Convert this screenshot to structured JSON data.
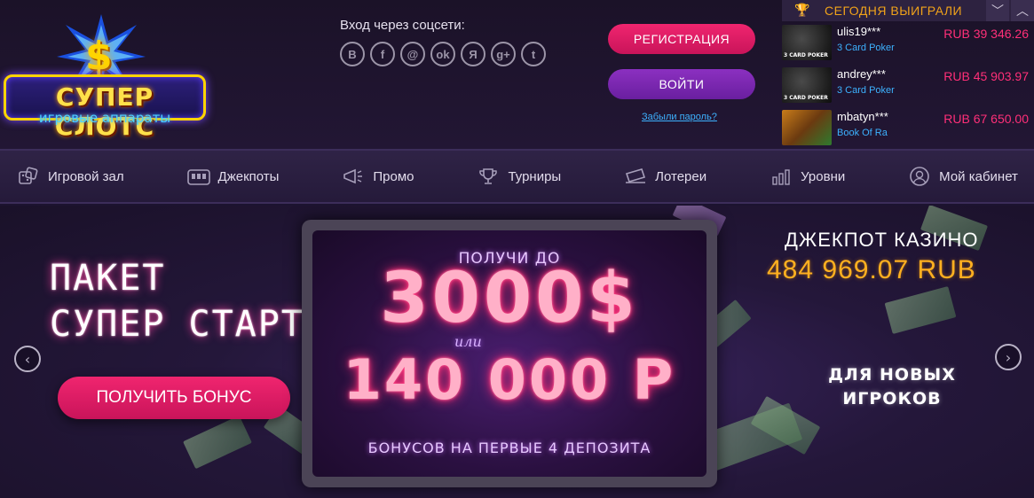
{
  "logo": {
    "title": "СУПЕР СЛОТС",
    "dollar": "$",
    "subtitle": "игровые аппараты"
  },
  "social": {
    "title": "Вход через соцсети:",
    "icons": [
      {
        "name": "vk-icon",
        "glyph": "В"
      },
      {
        "name": "facebook-icon",
        "glyph": "f"
      },
      {
        "name": "mail-icon",
        "glyph": "@"
      },
      {
        "name": "odnoklassniki-icon",
        "glyph": "ok"
      },
      {
        "name": "yandex-icon",
        "glyph": "Я"
      },
      {
        "name": "googleplus-icon",
        "glyph": "g+"
      },
      {
        "name": "twitter-icon",
        "glyph": "t"
      }
    ]
  },
  "auth": {
    "register_label": "РЕГИСТРАЦИЯ",
    "login_label": "ВОЙТИ",
    "forgot_label": "Забыли пароль?"
  },
  "winners": {
    "title": "СЕГОДНЯ ВЫИГРАЛИ",
    "rows": [
      {
        "user": "ulis19***",
        "game": "3 Card Poker",
        "amount": "RUB 39 346.26"
      },
      {
        "user": "andrey***",
        "game": "3 Card Poker",
        "amount": "RUB 45 903.97"
      },
      {
        "user": "mbatyn***",
        "game": "Book Of Ra",
        "amount": "RUB 67 650.00"
      }
    ]
  },
  "nav": {
    "items": [
      {
        "label": "Игровой зал",
        "icon": "dice-icon"
      },
      {
        "label": "Джекпоты",
        "icon": "slot-machine-icon"
      },
      {
        "label": "Промо",
        "icon": "megaphone-icon"
      },
      {
        "label": "Турниры",
        "icon": "trophy-icon"
      },
      {
        "label": "Лотереи",
        "icon": "ticket-icon"
      },
      {
        "label": "Уровни",
        "icon": "levels-icon"
      },
      {
        "label": "Мой кабинет",
        "icon": "user-icon"
      }
    ]
  },
  "banner": {
    "promo_title_line1": "ПАКЕТ",
    "promo_title_line2": "СУПЕР СТАРТ",
    "bonus_button": "ПОЛУЧИТЬ БОНУС",
    "screen_top": "ПОЛУЧИ ДО",
    "screen_big": "3000$",
    "screen_or": "или",
    "screen_big2": "140 000 Р",
    "screen_bottom": "БОНУСОВ НА ПЕРВЫЕ 4 ДЕПОЗИТА",
    "jackpot_title": "ДЖЕКПОТ КАЗИНО",
    "jackpot_amount": "484 969.07 RUB",
    "new_players_line1": "ДЛЯ НОВЫХ",
    "new_players_line2": "ИГРОКОВ"
  },
  "colors": {
    "accent_pink": "#f0256f",
    "accent_purple": "#8b30c0",
    "link_blue": "#3db2ff",
    "gold": "#f0a21a"
  }
}
